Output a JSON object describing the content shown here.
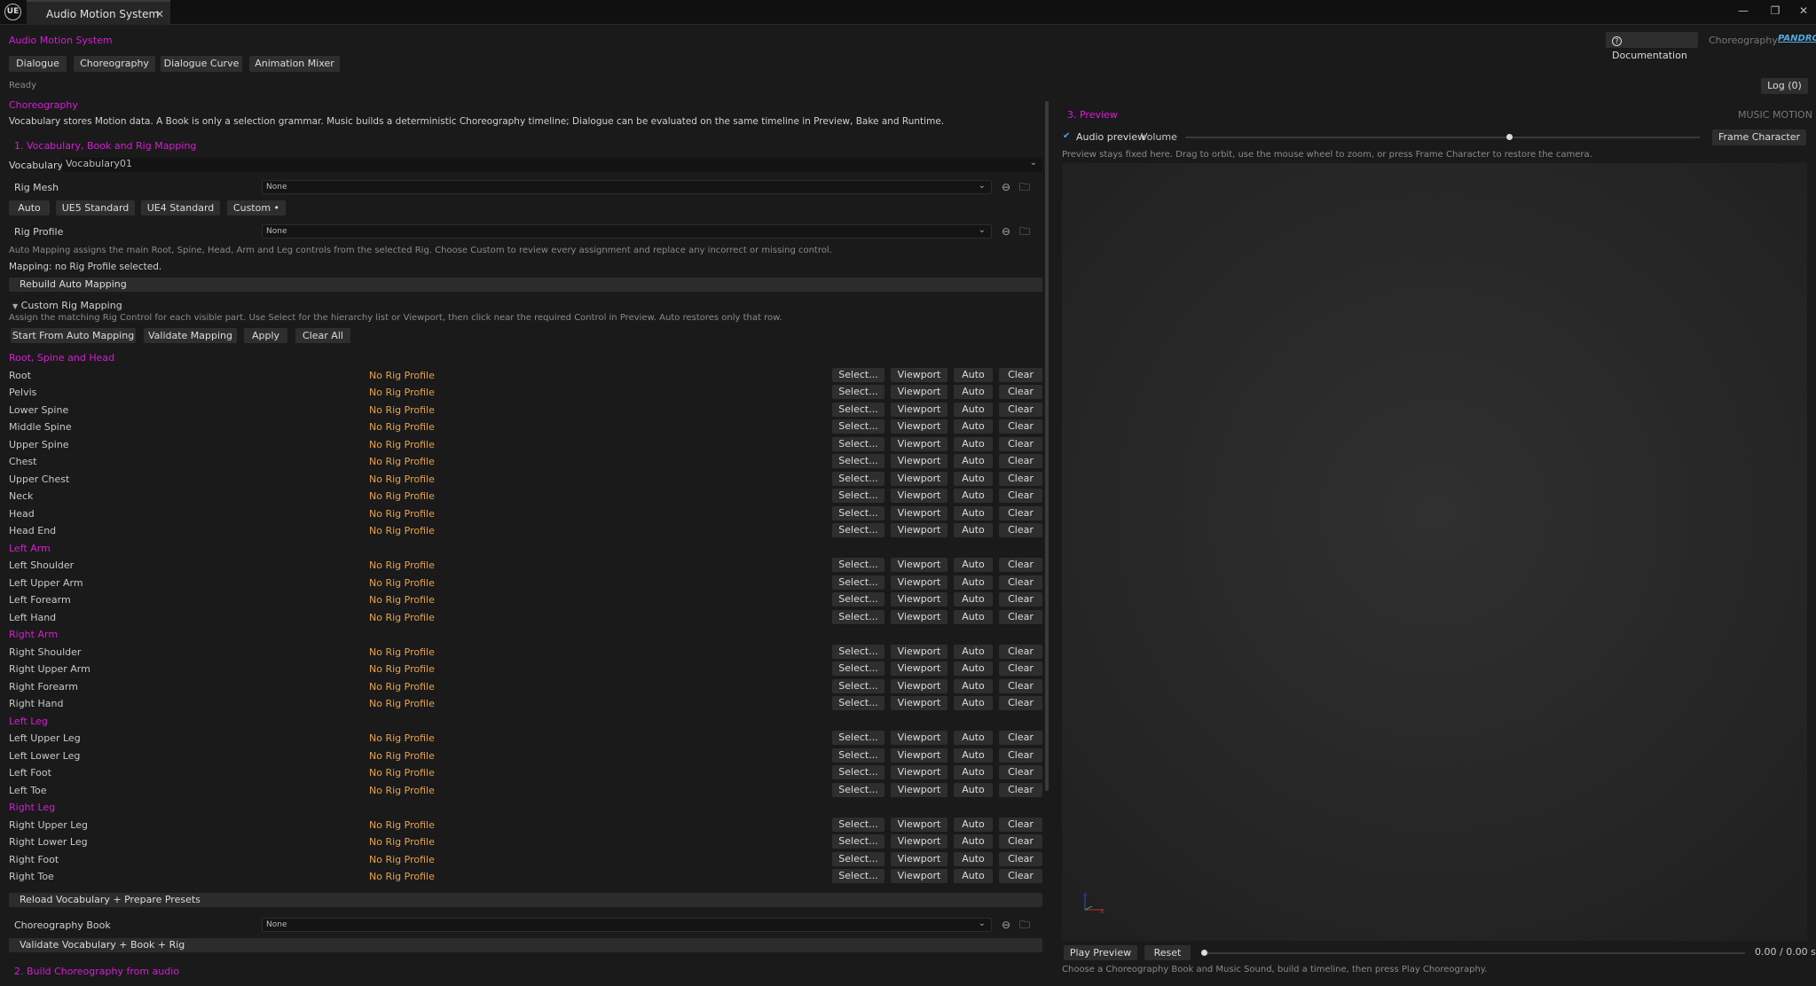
{
  "window": {
    "logo": "UE",
    "tab_title": "Audio Motion System",
    "close_glyph": "✕",
    "min_glyph": "—",
    "restore_glyph": "❐",
    "close_win_glyph": "✕"
  },
  "header": {
    "app_title": "Audio Motion System",
    "documentation": "Documentation",
    "mode": "Choreography",
    "brand": "PANDRCA"
  },
  "main_tabs": [
    "Dialogue",
    "Choreography",
    "Dialogue Curve",
    "Animation Mixer"
  ],
  "status": "Ready",
  "log_button": "Log (0)",
  "left": {
    "section_title": "Choreography",
    "description": "Vocabulary stores Motion data. A Book is only a selection grammar. Music builds a deterministic Choreography timeline; Dialogue can be evaluated on the same timeline in Preview, Bake and Runtime.",
    "step1": "1. Vocabulary, Book and Rig Mapping",
    "vocabulary_label": "Vocabulary",
    "vocabulary_value": "Vocabulary01",
    "rig_mesh_label": "Rig Mesh",
    "rig_mesh_value": "None",
    "presets": [
      "Auto",
      "UE5 Standard",
      "UE4 Standard",
      "Custom •"
    ],
    "rig_profile_label": "Rig Profile",
    "rig_profile_value": "None",
    "auto_mapping_hint": "Auto Mapping assigns the main Root, Spine, Head, Arm and Leg controls from the selected Rig. Choose Custom to review every assignment and replace any incorrect or missing control.",
    "mapping_status": "Mapping: no Rig Profile selected.",
    "rebuild_button": "Rebuild Auto Mapping",
    "custom_header": "Custom Rig Mapping",
    "custom_hint": "Assign the matching Rig Control for each visible part. Use Select for the hierarchy list or Viewport, then click near the required Control in Preview. Auto restores only that row.",
    "custom_actions": [
      "Start From Auto Mapping",
      "Validate Mapping",
      "Apply",
      "Clear All"
    ],
    "row_buttons": [
      "Select...",
      "Viewport",
      "Auto",
      "Clear"
    ],
    "groups": [
      {
        "name": "Root, Spine and Head",
        "rows": [
          {
            "label": "Root",
            "value": "No Rig Profile"
          },
          {
            "label": "Pelvis",
            "value": "No Rig Profile"
          },
          {
            "label": "Lower Spine",
            "value": "No Rig Profile"
          },
          {
            "label": "Middle Spine",
            "value": "No Rig Profile"
          },
          {
            "label": "Upper Spine",
            "value": "No Rig Profile"
          },
          {
            "label": "Chest",
            "value": "No Rig Profile"
          },
          {
            "label": "Upper Chest",
            "value": "No Rig Profile"
          },
          {
            "label": "Neck",
            "value": "No Rig Profile"
          },
          {
            "label": "Head",
            "value": "No Rig Profile"
          },
          {
            "label": "Head End",
            "value": "No Rig Profile"
          }
        ]
      },
      {
        "name": "Left Arm",
        "rows": [
          {
            "label": "Left Shoulder",
            "value": "No Rig Profile"
          },
          {
            "label": "Left Upper Arm",
            "value": "No Rig Profile"
          },
          {
            "label": "Left Forearm",
            "value": "No Rig Profile"
          },
          {
            "label": "Left Hand",
            "value": "No Rig Profile"
          }
        ]
      },
      {
        "name": "Right Arm",
        "rows": [
          {
            "label": "Right Shoulder",
            "value": "No Rig Profile"
          },
          {
            "label": "Right Upper Arm",
            "value": "No Rig Profile"
          },
          {
            "label": "Right Forearm",
            "value": "No Rig Profile"
          },
          {
            "label": "Right Hand",
            "value": "No Rig Profile"
          }
        ]
      },
      {
        "name": "Left Leg",
        "rows": [
          {
            "label": "Left Upper Leg",
            "value": "No Rig Profile"
          },
          {
            "label": "Left Lower Leg",
            "value": "No Rig Profile"
          },
          {
            "label": "Left Foot",
            "value": "No Rig Profile"
          },
          {
            "label": "Left Toe",
            "value": "No Rig Profile"
          }
        ]
      },
      {
        "name": "Right Leg",
        "rows": [
          {
            "label": "Right Upper Leg",
            "value": "No Rig Profile"
          },
          {
            "label": "Right Lower Leg",
            "value": "No Rig Profile"
          },
          {
            "label": "Right Foot",
            "value": "No Rig Profile"
          },
          {
            "label": "Right Toe",
            "value": "No Rig Profile"
          }
        ]
      }
    ],
    "reload_button": "Reload Vocabulary + Prepare Presets",
    "book_label": "Choreography Book",
    "book_value": "None",
    "validate_all_button": "Validate Vocabulary + Book + Rig",
    "step2": "2. Build Choreography from audio"
  },
  "preview": {
    "title": "3. Preview",
    "mode": "MUSIC MOTION",
    "audio_preview_label": "Audio preview",
    "audio_preview_checked": true,
    "volume_label": "Volume",
    "volume_level": 0.63,
    "frame_button": "Frame Character",
    "hint": "Preview stays fixed here. Drag to orbit, use the mouse wheel to zoom, or press Frame Character to restore the camera.",
    "play_button": "Play Preview",
    "reset_button": "Reset",
    "time_readout": "0.00 / 0.00 s",
    "time_progress": 0,
    "bottom_hint": "Choose a Choreography Book and Music Sound, build a timeline, then press Play Choreography.",
    "gizmo": {
      "x": "X",
      "z": "Z"
    }
  },
  "colors": {
    "accent": "#d41ed4",
    "warning": "#e8a24a",
    "check": "#4a9eff"
  }
}
